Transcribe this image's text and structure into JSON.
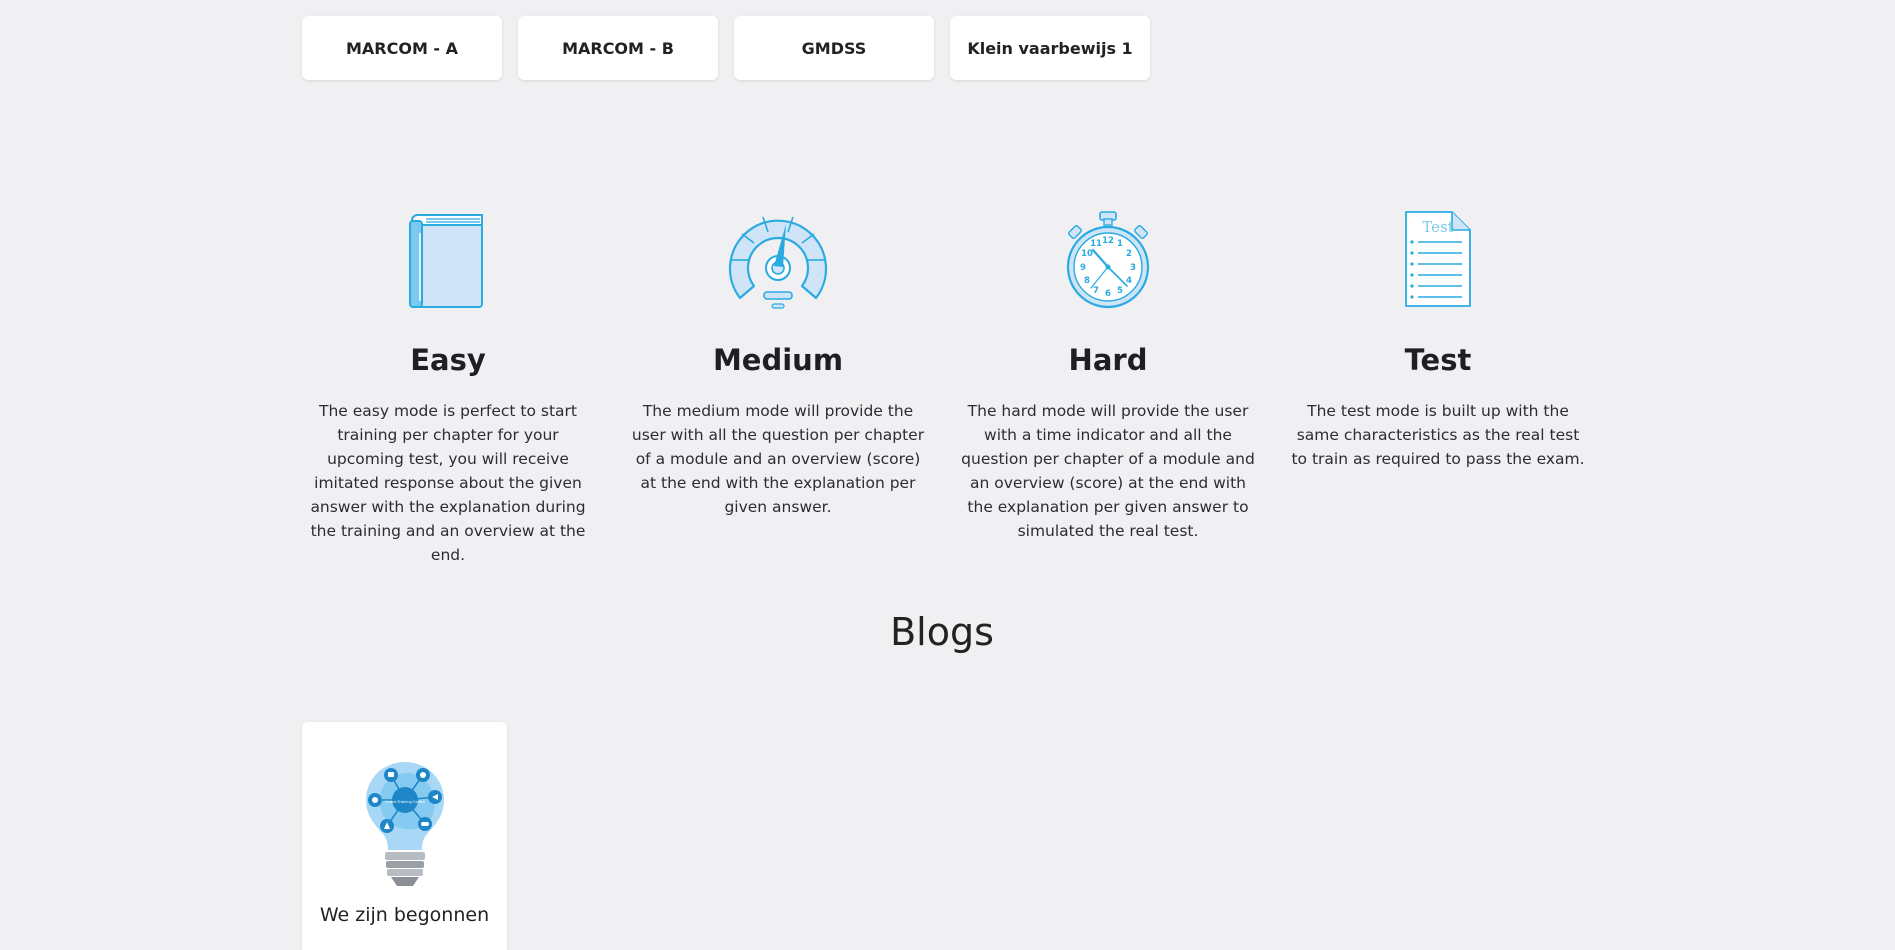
{
  "modules": [
    {
      "label": "MARCOM - A"
    },
    {
      "label": "MARCOM - B"
    },
    {
      "label": "GMDSS"
    },
    {
      "label": "Klein vaarbewijs 1"
    }
  ],
  "modes": [
    {
      "icon": "book-icon",
      "title": "Easy",
      "text": "The easy mode is perfect to start training per chapter for your upcoming test, you will receive imitated response about the given answer with the explanation during the training and an overview at the end."
    },
    {
      "icon": "speedometer-icon",
      "title": "Medium",
      "text": "The medium mode will provide the user with all the question per chapter of a module and an overview (score) at the end with the explanation per given answer."
    },
    {
      "icon": "stopwatch-icon",
      "title": "Hard",
      "text": "The hard mode will provide the user with a time indicator and all the question per chapter of a module and an overview (score) at the end with the explanation per given answer to simulated the real test."
    },
    {
      "icon": "test-document-icon",
      "title": "Test",
      "text": "The test mode is built up with the same characteristics as the real test to train as required to pass the exam."
    }
  ],
  "blogs": {
    "heading": "Blogs",
    "posts": [
      {
        "title": "We zijn begonnen",
        "image": "lightbulb-icon",
        "bulb_text": "Online Training Centre"
      }
    ]
  },
  "icon_labels": {
    "test_doc": "Test",
    "clock_numbers": [
      "12",
      "1",
      "2",
      "3",
      "4",
      "5",
      "6",
      "7",
      "8",
      "9",
      "10",
      "11"
    ]
  },
  "colors": {
    "background": "#f0f0f2",
    "card": "#ffffff",
    "accent": "#29abe2",
    "accent_light": "#cfe4f7"
  }
}
